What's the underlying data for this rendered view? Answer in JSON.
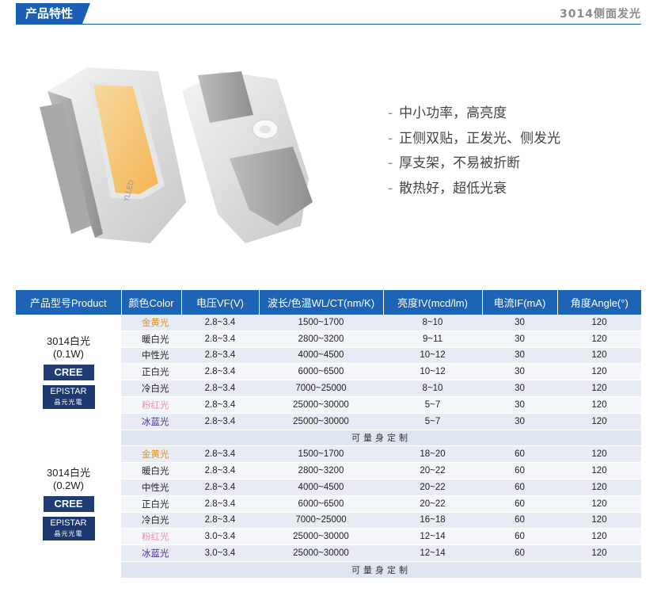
{
  "header": {
    "tab_label": "产品特性",
    "right_title": "3014侧面发光"
  },
  "product_image": {
    "marking": "YLLED"
  },
  "features": [
    "中小功率，高亮度",
    "正侧双贴，正发光、侧发光",
    "厚支架，不易被折断",
    "散热好，超低光衰"
  ],
  "table": {
    "headers": [
      "产品型号Product",
      "颜色Color",
      "电压VF(V)",
      "波长/色温WL/CT(nm/K)",
      "亮度IV(mcd/lm)",
      "电流IF(mA)",
      "角度Angle(°)"
    ],
    "groups": [
      {
        "product_line1": "3014白光",
        "product_line2": "(0.1W)",
        "logo_cree": "CREE",
        "logo_epistar_line1": "EPISTAR",
        "logo_epistar_line2": "晶元光電",
        "rows": [
          [
            "金黄光",
            "2.8~3.4",
            "1500~1700",
            "8~10",
            "30",
            "120"
          ],
          [
            "暖白光",
            "2.8~3.4",
            "2800~3200",
            "9~11",
            "30",
            "120"
          ],
          [
            "中性光",
            "2.8~3.4",
            "4000~4500",
            "10~12",
            "30",
            "120"
          ],
          [
            "正白光",
            "2.8~3.4",
            "6000~6500",
            "10~12",
            "30",
            "120"
          ],
          [
            "冷白光",
            "2.8~3.4",
            "7000~25000",
            "8~10",
            "30",
            "120"
          ],
          [
            "粉红光",
            "2.8~3.4",
            "25000~30000",
            "5~7",
            "30",
            "120"
          ],
          [
            "冰蓝光",
            "2.8~3.4",
            "25000~30000",
            "5~7",
            "30",
            "120"
          ]
        ],
        "custom_label": "可量身定制"
      },
      {
        "product_line1": "3014白光",
        "product_line2": "(0.2W)",
        "logo_cree": "CREE",
        "logo_epistar_line1": "EPISTAR",
        "logo_epistar_line2": "晶元光電",
        "rows": [
          [
            "金黄光",
            "2.8~3.4",
            "1500~1700",
            "18~20",
            "60",
            "120"
          ],
          [
            "暖白光",
            "2.8~3.4",
            "2800~3200",
            "20~22",
            "60",
            "120"
          ],
          [
            "中性光",
            "2.8~3.4",
            "4000~4500",
            "20~22",
            "60",
            "120"
          ],
          [
            "正白光",
            "2.8~3.4",
            "6000~6500",
            "20~22",
            "60",
            "120"
          ],
          [
            "冷白光",
            "2.8~3.4",
            "7000~25000",
            "16~18",
            "60",
            "120"
          ],
          [
            "粉红光",
            "3.0~3.4",
            "25000~30000",
            "12~14",
            "60",
            "120"
          ],
          [
            "冰蓝光",
            "3.0~3.4",
            "25000~30000",
            "12~14",
            "60",
            "120"
          ]
        ],
        "custom_label": "可量身定制"
      }
    ]
  },
  "colors": {
    "accent": "#1d63b6",
    "gold": "#e38f1a",
    "pink": "#f08fb0",
    "ice_blue": "#4a2f9a"
  }
}
